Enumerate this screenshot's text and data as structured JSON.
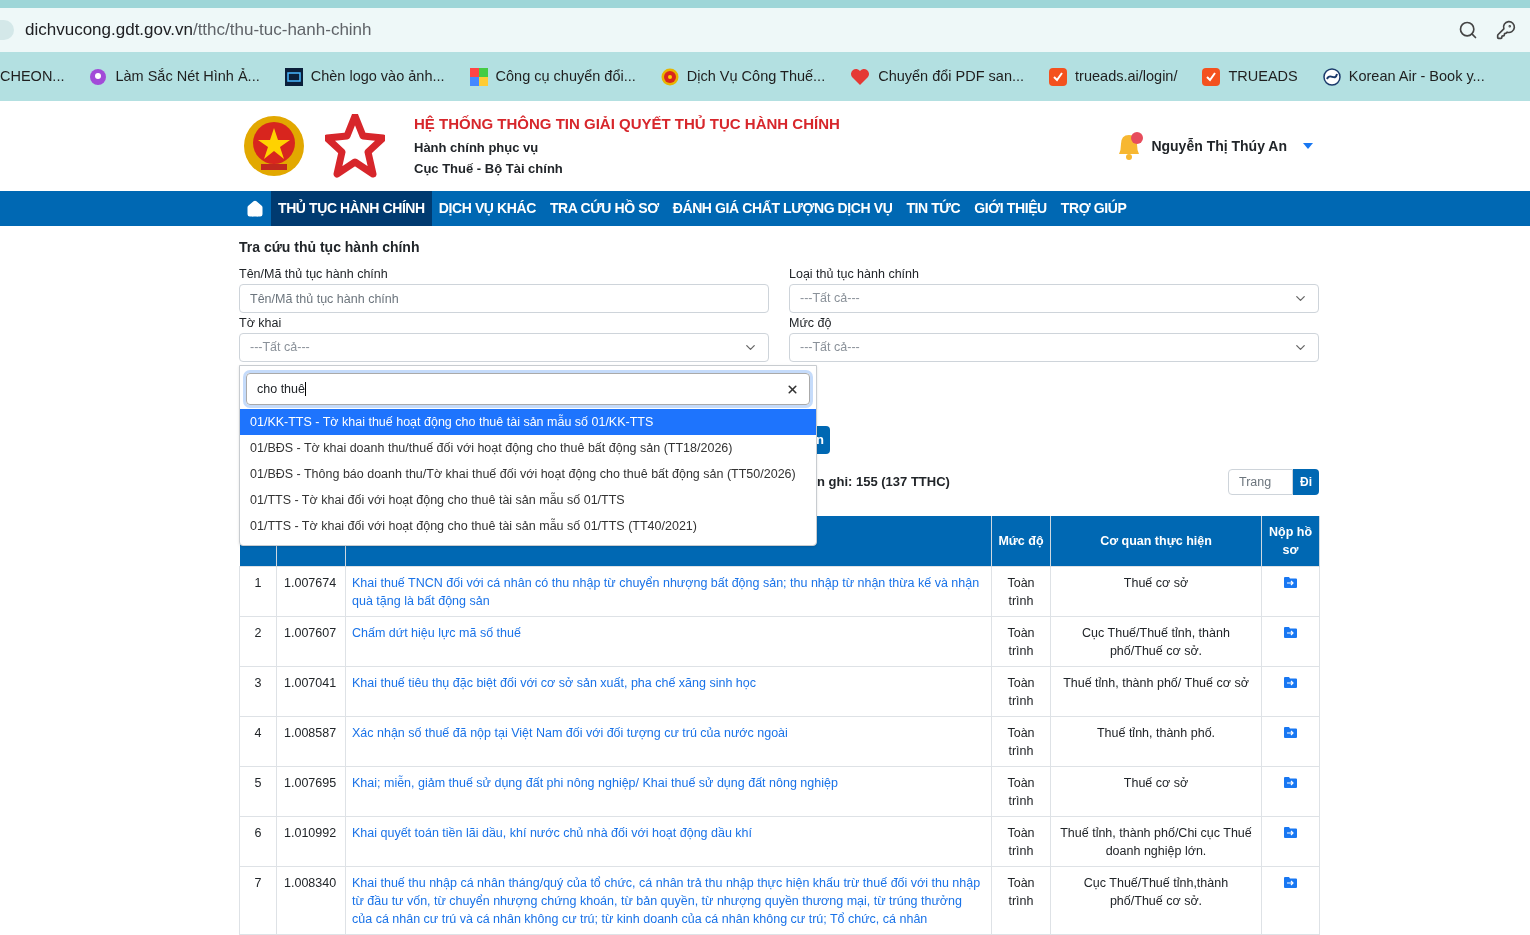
{
  "browser": {
    "url_host": "dichvucong.gdt.gov.vn",
    "url_path": "/tthc/thu-tuc-hanh-chinh",
    "bookmarks": [
      {
        "label": "CHEON...",
        "kind": "none"
      },
      {
        "label": "Làm Sắc Nét Hình Ả...",
        "kind": "picker"
      },
      {
        "label": "Chèn logo vào ảnh...",
        "kind": "pso"
      },
      {
        "label": "Công cụ chuyển đổi...",
        "kind": "grid"
      },
      {
        "label": "Dịch Vụ Công Thuế...",
        "kind": "emblem"
      },
      {
        "label": "Chuyển đổi PDF san...",
        "kind": "heart"
      },
      {
        "label": "trueads.ai/login/",
        "kind": "check"
      },
      {
        "label": "TRUEADS",
        "kind": "check"
      },
      {
        "label": "Korean Air - Book y...",
        "kind": "swirl"
      }
    ]
  },
  "header": {
    "title": "HỆ THỐNG THÔNG TIN GIẢI QUYẾT THỦ TỤC HÀNH CHÍNH",
    "lines": [
      "Hành chính phục vụ",
      "Cục Thuế - Bộ Tài chính"
    ],
    "user": "Nguyễn Thị Thúy An",
    "has_notification": true
  },
  "nav": [
    {
      "label": "THỦ TỤC HÀNH CHÍNH",
      "selected": true
    },
    {
      "label": "DỊCH VỤ KHÁC",
      "selected": false
    },
    {
      "label": "TRA CỨU HỒ SƠ",
      "selected": false
    },
    {
      "label": "ĐÁNH GIÁ CHẤT LƯỢNG DỊCH VỤ",
      "selected": false
    },
    {
      "label": "TIN TỨC",
      "selected": false
    },
    {
      "label": "GIỚI THIỆU",
      "selected": false
    },
    {
      "label": "TRỢ GIÚP",
      "selected": false
    }
  ],
  "search": {
    "title": "Tra cứu thủ tục hành chính",
    "fields": [
      {
        "label": "Tên/Mã thủ tục hành chính",
        "placeholder": "Tên/Mã thủ tục hành chính",
        "kind": "text"
      },
      {
        "label": "Loại thủ tục hành chính",
        "placeholder": "---Tất cả---",
        "kind": "select"
      },
      {
        "label": "Tờ khai",
        "placeholder": "---Tất cả---",
        "kind": "select"
      },
      {
        "label": "Mức độ",
        "placeholder": "---Tất cả---",
        "kind": "select"
      }
    ],
    "button_label": "n"
  },
  "dropdown": {
    "query": "cho thuê",
    "options": [
      {
        "label": "01/KK-TTS - Tờ khai thuế hoạt động cho thuê tài sản mẫu số 01/KK-TTS",
        "selected": true
      },
      {
        "label": "01/BĐS - Tờ khai doanh thu/thuế đối với hoạt động cho thuê bất động sản (TT18/2026)",
        "selected": false
      },
      {
        "label": "01/BĐS - Thông báo doanh thu/Tờ khai thuế đối với hoạt động cho thuê bất động sản (TT50/2026)",
        "selected": false
      },
      {
        "label": "01/TTS - Tờ khai đối với hoạt động cho thuê tài sản mẫu số 01/TTS",
        "selected": false
      },
      {
        "label": "01/TTS - Tờ khai đối với hoạt động cho thuê tài sản mẫu số 01/TTS (TT40/2021)",
        "selected": false
      }
    ]
  },
  "record_count": "n ghi: 155 (137 TTHC)",
  "pager": {
    "placeholder": "Trang",
    "button": "Đi"
  },
  "table": {
    "columns": [
      "Mức độ",
      "Cơ quan thực hiện",
      "Nộp hồ sơ"
    ],
    "rows": [
      {
        "no": "1",
        "code": "1.007674",
        "name": "Khai thuế TNCN đối với cá nhân có thu nhập từ chuyển nhượng bất động sản; thu nhập từ nhận thừa kế và nhận quà tặng là bất động sản",
        "level": "Toàn trình",
        "agency": "Thuế cơ sở"
      },
      {
        "no": "2",
        "code": "1.007607",
        "name": "Chấm dứt hiệu lực mã số thuế",
        "level": "Toàn trình",
        "agency": "Cục Thuế/Thuế tỉnh, thành phố/Thuế cơ sở."
      },
      {
        "no": "3",
        "code": "1.007041",
        "name": "Khai thuế tiêu thụ đặc biệt đối với cơ sở sản xuất, pha chế xăng sinh học",
        "level": "Toàn trình",
        "agency": "Thuế tỉnh, thành phố/ Thuế cơ sở"
      },
      {
        "no": "4",
        "code": "1.008587",
        "name": "Xác nhận số thuế đã nộp tại Việt Nam đối với đối tượng cư trú của nước ngoài",
        "level": "Toàn trình",
        "agency": "Thuế tỉnh, thành phố."
      },
      {
        "no": "5",
        "code": "1.007695",
        "name": "Khai; miễn, giảm thuế sử dụng đất phi nông nghiệp/ Khai thuế sử dụng đất nông nghiệp",
        "level": "Toàn trình",
        "agency": "Thuế cơ sở"
      },
      {
        "no": "6",
        "code": "1.010992",
        "name": "Khai quyết toán tiền lãi dầu, khí nước chủ nhà đối với hoạt động dầu khí",
        "level": "Toàn trình",
        "agency": "Thuế tỉnh, thành phố/Chi cục Thuế doanh nghiệp lớn."
      },
      {
        "no": "7",
        "code": "1.008340",
        "name": "Khai thuế thu nhập cá nhân tháng/quý của tổ chức, cá nhân trả thu nhập thực hiện khấu trừ thuế đối với thu nhập từ đầu tư vốn, từ chuyển nhượng chứng khoán, từ bản quyền, từ nhượng quyền thương mại, từ trúng thưởng của cá nhân cư trú và cá nhân không cư trú; từ kinh doanh của cá nhân không cư trú; Tổ chức, cá nhân",
        "level": "Toàn trình",
        "agency": "Cục Thuế/Thuế tỉnh,thành phố/Thuế cơ sở."
      }
    ]
  }
}
